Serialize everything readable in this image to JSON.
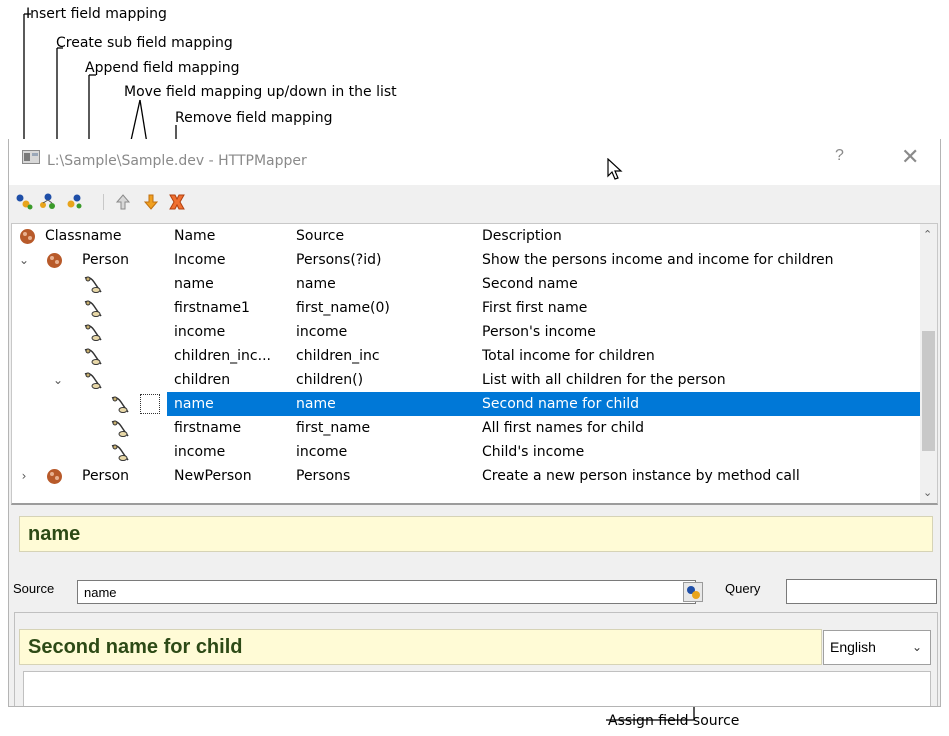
{
  "callouts": {
    "insert": "Insert field mapping",
    "create_sub": "Create sub field mapping",
    "append": "Append field mapping",
    "move": "Move field mapping up/down in the list",
    "remove": "Remove field mapping",
    "assign_source": "Assign field source"
  },
  "window": {
    "title": "L:\\Sample\\Sample.dev - HTTPMapper",
    "help": "?",
    "close": "✕"
  },
  "toolbar": {
    "icons": [
      "insert-field-mapping-icon",
      "create-sub-field-mapping-icon",
      "append-field-mapping-icon",
      "move-up-icon",
      "move-down-icon",
      "remove-field-mapping-icon"
    ]
  },
  "tree": {
    "headers": {
      "classname": "Classname",
      "name": "Name",
      "source": "Source",
      "description": "Description"
    },
    "rows": [
      {
        "classname": "Person",
        "name": "Income",
        "source": "Persons(?id)",
        "description": "Show the persons income and income for children"
      },
      {
        "classname": "",
        "name": "name",
        "source": "name",
        "description": "Second name"
      },
      {
        "classname": "",
        "name": "firstname1",
        "source": "first_name(0)",
        "description": "First first name"
      },
      {
        "classname": "",
        "name": "income",
        "source": "income",
        "description": "Person's income"
      },
      {
        "classname": "",
        "name": "children_inc...",
        "source": "children_inc",
        "description": "Total income for children"
      },
      {
        "classname": "",
        "name": "children",
        "source": "children()",
        "description": "List with all children for the person"
      },
      {
        "classname": "",
        "name": "name",
        "source": "name",
        "description": "Second name for child",
        "selected": true
      },
      {
        "classname": "",
        "name": "firstname",
        "source": "first_name",
        "description": "All first names for child"
      },
      {
        "classname": "",
        "name": "income",
        "source": "income",
        "description": "Child's income"
      },
      {
        "classname": "Person",
        "name": "NewPerson",
        "source": "Persons",
        "description": "Create a new person instance by method call"
      }
    ]
  },
  "detail": {
    "name_value": "name",
    "source_label": "Source",
    "source_value": "name",
    "query_label": "Query",
    "query_value": "",
    "description_value": "Second name for child",
    "language": "English"
  },
  "colors": {
    "selection": "#0078d7",
    "highlight_bg": "#fffbd6",
    "highlight_text": "#2d4a16"
  }
}
